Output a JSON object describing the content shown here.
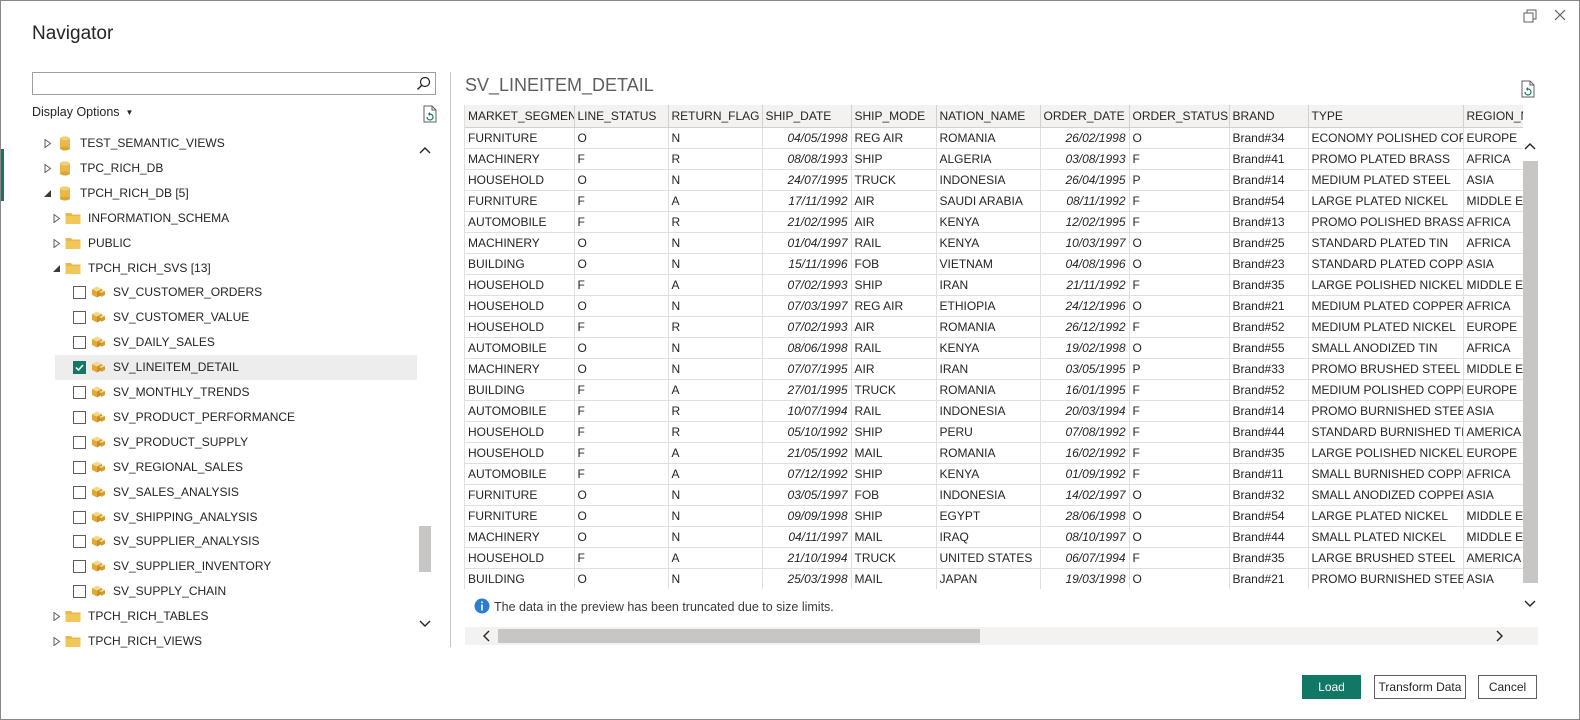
{
  "window": {
    "title": "Navigator"
  },
  "colors": {
    "accent": "#117865",
    "folder": "#e8b94a",
    "db": "#e8b94a",
    "info": "#2b7cd3"
  },
  "left_pane": {
    "search_placeholder": "",
    "display_options_label": "Display Options",
    "tree": [
      {
        "label": "TEST_SEMANTIC_VIEWS",
        "icon": "database-icon",
        "expander": "collapsed",
        "checkbox": null,
        "selected": false
      },
      {
        "label": "TPC_RICH_DB",
        "icon": "database-icon",
        "expander": "collapsed",
        "checkbox": null,
        "selected": false
      },
      {
        "label": "TPCH_RICH_DB [5]",
        "icon": "database-icon",
        "expander": "expanded",
        "checkbox": null,
        "selected": false
      },
      {
        "label": "INFORMATION_SCHEMA",
        "icon": "folder-icon",
        "expander": "collapsed",
        "checkbox": null,
        "selected": false
      },
      {
        "label": "PUBLIC",
        "icon": "folder-icon",
        "expander": "collapsed",
        "checkbox": null,
        "selected": false
      },
      {
        "label": "TPCH_RICH_SVS [13]",
        "icon": "folder-icon",
        "expander": "expanded",
        "checkbox": null,
        "selected": false
      },
      {
        "label": "SV_CUSTOMER_ORDERS",
        "icon": "cube-icon",
        "expander": null,
        "checkbox": false,
        "selected": false
      },
      {
        "label": "SV_CUSTOMER_VALUE",
        "icon": "cube-icon",
        "expander": null,
        "checkbox": false,
        "selected": false
      },
      {
        "label": "SV_DAILY_SALES",
        "icon": "cube-icon",
        "expander": null,
        "checkbox": false,
        "selected": false
      },
      {
        "label": "SV_LINEITEM_DETAIL",
        "icon": "cube-icon",
        "expander": null,
        "checkbox": true,
        "selected": true
      },
      {
        "label": "SV_MONTHLY_TRENDS",
        "icon": "cube-icon",
        "expander": null,
        "checkbox": false,
        "selected": false
      },
      {
        "label": "SV_PRODUCT_PERFORMANCE",
        "icon": "cube-icon",
        "expander": null,
        "checkbox": false,
        "selected": false
      },
      {
        "label": "SV_PRODUCT_SUPPLY",
        "icon": "cube-icon",
        "expander": null,
        "checkbox": false,
        "selected": false
      },
      {
        "label": "SV_REGIONAL_SALES",
        "icon": "cube-icon",
        "expander": null,
        "checkbox": false,
        "selected": false
      },
      {
        "label": "SV_SALES_ANALYSIS",
        "icon": "cube-icon",
        "expander": null,
        "checkbox": false,
        "selected": false
      },
      {
        "label": "SV_SHIPPING_ANALYSIS",
        "icon": "cube-icon",
        "expander": null,
        "checkbox": false,
        "selected": false
      },
      {
        "label": "SV_SUPPLIER_ANALYSIS",
        "icon": "cube-icon",
        "expander": null,
        "checkbox": false,
        "selected": false
      },
      {
        "label": "SV_SUPPLIER_INVENTORY",
        "icon": "cube-icon",
        "expander": null,
        "checkbox": false,
        "selected": false
      },
      {
        "label": "SV_SUPPLY_CHAIN",
        "icon": "cube-icon",
        "expander": null,
        "checkbox": false,
        "selected": false
      },
      {
        "label": "TPCH_RICH_TABLES",
        "icon": "folder-icon",
        "expander": "collapsed",
        "checkbox": null,
        "selected": false
      },
      {
        "label": "TPCH_RICH_VIEWS",
        "icon": "folder-icon",
        "expander": "collapsed",
        "checkbox": null,
        "selected": false
      }
    ]
  },
  "preview": {
    "title": "SV_LINEITEM_DETAIL",
    "columns": [
      "MARKET_SEGMENT",
      "LINE_STATUS",
      "RETURN_FLAG",
      "SHIP_DATE",
      "SHIP_MODE",
      "NATION_NAME",
      "ORDER_DATE",
      "ORDER_STATUS",
      "BRAND",
      "TYPE",
      "REGION_NAME"
    ],
    "date_columns": [
      3,
      6
    ],
    "rows": [
      [
        "FURNITURE",
        "O",
        "N",
        "04/05/1998",
        "REG AIR",
        "ROMANIA",
        "26/02/1998",
        "O",
        "Brand#34",
        "ECONOMY POLISHED COPPER",
        "EUROPE"
      ],
      [
        "MACHINERY",
        "F",
        "R",
        "08/08/1993",
        "SHIP",
        "ALGERIA",
        "03/08/1993",
        "F",
        "Brand#41",
        "PROMO PLATED BRASS",
        "AFRICA"
      ],
      [
        "HOUSEHOLD",
        "O",
        "N",
        "24/07/1995",
        "TRUCK",
        "INDONESIA",
        "26/04/1995",
        "P",
        "Brand#14",
        "MEDIUM PLATED STEEL",
        "ASIA"
      ],
      [
        "FURNITURE",
        "F",
        "A",
        "17/11/1992",
        "AIR",
        "SAUDI ARABIA",
        "08/11/1992",
        "F",
        "Brand#54",
        "LARGE PLATED NICKEL",
        "MIDDLE EAST"
      ],
      [
        "AUTOMOBILE",
        "F",
        "R",
        "21/02/1995",
        "AIR",
        "KENYA",
        "12/02/1995",
        "F",
        "Brand#13",
        "PROMO POLISHED BRASS",
        "AFRICA"
      ],
      [
        "MACHINERY",
        "O",
        "N",
        "01/04/1997",
        "RAIL",
        "KENYA",
        "10/03/1997",
        "O",
        "Brand#25",
        "STANDARD PLATED TIN",
        "AFRICA"
      ],
      [
        "BUILDING",
        "O",
        "N",
        "15/11/1996",
        "FOB",
        "VIETNAM",
        "04/08/1996",
        "O",
        "Brand#23",
        "STANDARD PLATED COPPER",
        "ASIA"
      ],
      [
        "HOUSEHOLD",
        "F",
        "A",
        "07/02/1993",
        "SHIP",
        "IRAN",
        "21/11/1992",
        "F",
        "Brand#35",
        "LARGE POLISHED NICKEL",
        "MIDDLE EAST"
      ],
      [
        "HOUSEHOLD",
        "O",
        "N",
        "07/03/1997",
        "REG AIR",
        "ETHIOPIA",
        "24/12/1996",
        "O",
        "Brand#21",
        "MEDIUM PLATED COPPER",
        "AFRICA"
      ],
      [
        "HOUSEHOLD",
        "F",
        "R",
        "07/02/1993",
        "AIR",
        "ROMANIA",
        "26/12/1992",
        "F",
        "Brand#52",
        "MEDIUM PLATED NICKEL",
        "EUROPE"
      ],
      [
        "AUTOMOBILE",
        "O",
        "N",
        "08/06/1998",
        "RAIL",
        "KENYA",
        "19/02/1998",
        "O",
        "Brand#55",
        "SMALL ANODIZED TIN",
        "AFRICA"
      ],
      [
        "MACHINERY",
        "O",
        "N",
        "07/07/1995",
        "AIR",
        "IRAN",
        "03/05/1995",
        "P",
        "Brand#33",
        "PROMO BRUSHED STEEL",
        "MIDDLE EAST"
      ],
      [
        "BUILDING",
        "F",
        "A",
        "27/01/1995",
        "TRUCK",
        "ROMANIA",
        "16/01/1995",
        "F",
        "Brand#52",
        "MEDIUM POLISHED COPPER",
        "EUROPE"
      ],
      [
        "AUTOMOBILE",
        "F",
        "R",
        "10/07/1994",
        "RAIL",
        "INDONESIA",
        "20/03/1994",
        "F",
        "Brand#14",
        "PROMO BURNISHED STEEL",
        "ASIA"
      ],
      [
        "HOUSEHOLD",
        "F",
        "R",
        "05/10/1992",
        "SHIP",
        "PERU",
        "07/08/1992",
        "F",
        "Brand#44",
        "STANDARD BURNISHED TIN",
        "AMERICA"
      ],
      [
        "HOUSEHOLD",
        "F",
        "A",
        "21/05/1992",
        "MAIL",
        "ROMANIA",
        "16/02/1992",
        "F",
        "Brand#35",
        "LARGE POLISHED NICKEL",
        "EUROPE"
      ],
      [
        "AUTOMOBILE",
        "F",
        "A",
        "07/12/1992",
        "SHIP",
        "KENYA",
        "01/09/1992",
        "F",
        "Brand#11",
        "SMALL BURNISHED COPPER",
        "AFRICA"
      ],
      [
        "FURNITURE",
        "O",
        "N",
        "03/05/1997",
        "FOB",
        "INDONESIA",
        "14/02/1997",
        "O",
        "Brand#32",
        "SMALL ANODIZED COPPER",
        "ASIA"
      ],
      [
        "FURNITURE",
        "O",
        "N",
        "09/09/1998",
        "SHIP",
        "EGYPT",
        "28/06/1998",
        "O",
        "Brand#54",
        "LARGE PLATED NICKEL",
        "MIDDLE EAST"
      ],
      [
        "MACHINERY",
        "O",
        "N",
        "04/11/1997",
        "MAIL",
        "IRAQ",
        "08/10/1997",
        "O",
        "Brand#44",
        "SMALL PLATED NICKEL",
        "MIDDLE EAST"
      ],
      [
        "HOUSEHOLD",
        "F",
        "A",
        "21/10/1994",
        "TRUCK",
        "UNITED STATES",
        "06/07/1994",
        "F",
        "Brand#35",
        "LARGE BRUSHED STEEL",
        "AMERICA"
      ],
      [
        "BUILDING",
        "O",
        "N",
        "25/03/1998",
        "MAIL",
        "JAPAN",
        "19/03/1998",
        "O",
        "Brand#21",
        "PROMO BURNISHED STEEL",
        "ASIA"
      ]
    ],
    "truncation_note": "The data in the preview has been truncated due to size limits."
  },
  "buttons": {
    "load": "Load",
    "transform": "Transform Data",
    "cancel": "Cancel"
  }
}
